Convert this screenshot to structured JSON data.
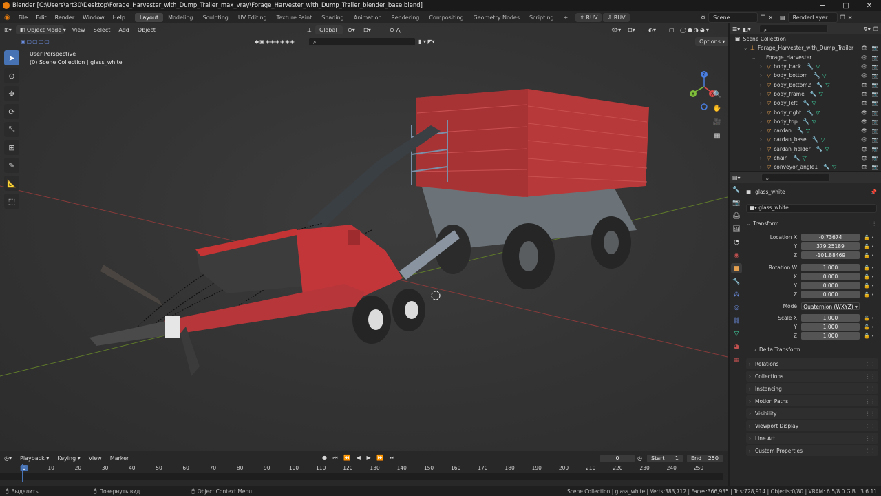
{
  "window": {
    "title": "Blender [C:\\Users\\art30\\Desktop\\Forage_Harvester_with_Dump_Trailer_max_vray\\Forage_Harvester_with_Dump_Trailer_blender_base.blend]",
    "controls": {
      "minimize": "─",
      "maximize": "□",
      "close": "✕"
    }
  },
  "menu": [
    "File",
    "Edit",
    "Render",
    "Window",
    "Help"
  ],
  "workspaces": [
    "Layout",
    "Modeling",
    "Sculpting",
    "UV Editing",
    "Texture Paint",
    "Shading",
    "Animation",
    "Rendering",
    "Compositing",
    "Geometry Nodes",
    "Scripting"
  ],
  "workspace_add": "+",
  "ruv_buttons": [
    "RUV",
    "RUV"
  ],
  "scene": {
    "name": "Scene",
    "render_layer": "RenderLayer"
  },
  "viewport": {
    "mode": "Object Mode",
    "menus": [
      "View",
      "Select",
      "Add",
      "Object"
    ],
    "orientation": "Global",
    "options": "Options",
    "perspective": "User Perspective",
    "collection_info": "(0) Scene Collection | glass_white"
  },
  "outliner": {
    "root": "Scene Collection",
    "items": [
      {
        "label": "Forage_Harvester_with_Dump_Trailer",
        "depth": 1
      },
      {
        "label": "Forage_Harvester",
        "depth": 2
      },
      {
        "label": "body_back",
        "depth": 3
      },
      {
        "label": "body_bottom",
        "depth": 3
      },
      {
        "label": "body_bottom2",
        "depth": 3
      },
      {
        "label": "body_frame",
        "depth": 3
      },
      {
        "label": "body_left",
        "depth": 3
      },
      {
        "label": "body_right",
        "depth": 3
      },
      {
        "label": "body_top",
        "depth": 3
      },
      {
        "label": "cardan",
        "depth": 3
      },
      {
        "label": "cardan_base",
        "depth": 3
      },
      {
        "label": "cardan_holder",
        "depth": 3
      },
      {
        "label": "chain",
        "depth": 3
      },
      {
        "label": "conveyor_angle1",
        "depth": 3
      }
    ]
  },
  "properties": {
    "object_name": "glass_white",
    "data_name": "glass_white",
    "transform_title": "Transform",
    "location": {
      "label": "Location X",
      "x": "-0.73674",
      "y": "379.25189",
      "z": "-101.88469"
    },
    "rotation": {
      "label": "Rotation W",
      "w": "1.000",
      "x": "0.000",
      "y": "0.000",
      "z": "0.000"
    },
    "mode_label": "Mode",
    "mode_value": "Quaternion (WXYZ)",
    "scale": {
      "label": "Scale X",
      "x": "1.000",
      "y": "1.000",
      "z": "1.000"
    },
    "axis_y": "Y",
    "axis_z": "Z",
    "axis_x": "X",
    "delta": "Delta Transform",
    "panels": [
      "Relations",
      "Collections",
      "Instancing",
      "Motion Paths",
      "Visibility",
      "Viewport Display",
      "Line Art",
      "Custom Properties"
    ]
  },
  "timeline": {
    "menus": [
      "Playback",
      "Keying",
      "View",
      "Marker"
    ],
    "current_frame": "0",
    "start_label": "Start",
    "start": "1",
    "end_label": "End",
    "end": "250",
    "ticks": [
      "0",
      "10",
      "20",
      "30",
      "40",
      "50",
      "60",
      "70",
      "80",
      "90",
      "100",
      "110",
      "120",
      "130",
      "140",
      "150",
      "160",
      "170",
      "180",
      "190",
      "200",
      "210",
      "220",
      "230",
      "240",
      "250"
    ]
  },
  "status": {
    "select": "Выделить",
    "rotate": "Повернуть вид",
    "context": "Object Context Menu",
    "stats": "Scene Collection | glass_white | Verts:383,712 | Faces:366,935 | Tris:728,914 | Objects:0/80 | VRAM: 6.5/8.0 GiB | 3.6.11"
  },
  "colors": {
    "accent": "#4772b3",
    "blender_orange": "#e87d0d",
    "trailer_red": "#b8393a"
  }
}
